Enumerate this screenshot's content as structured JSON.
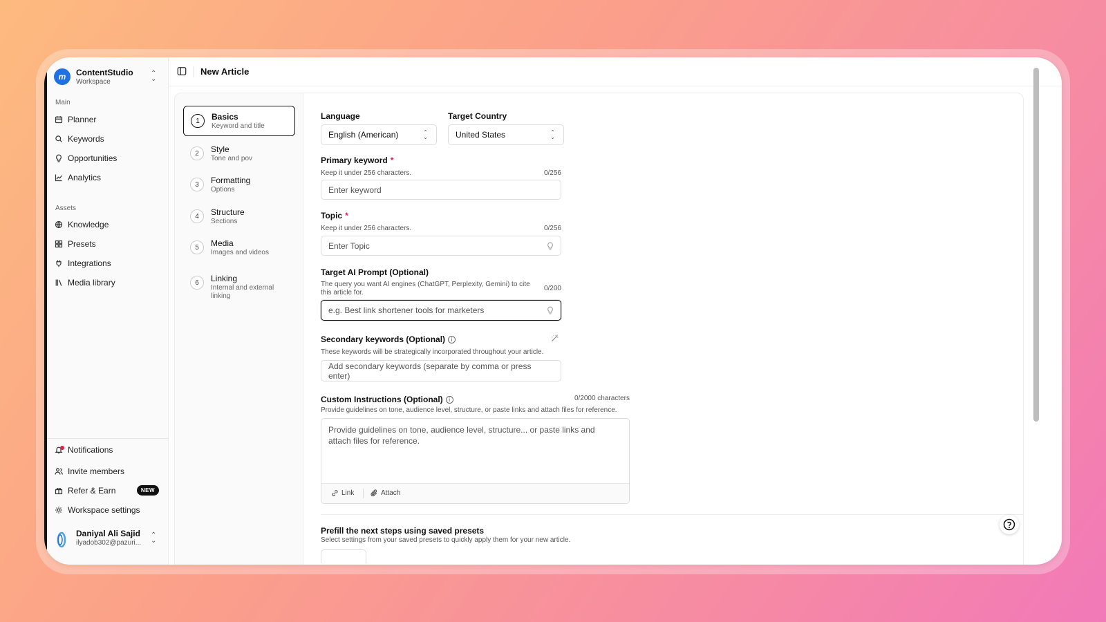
{
  "workspace": {
    "name": "ContentStudio",
    "sub": "Workspace",
    "logo": "m"
  },
  "sidebar": {
    "main_label": "Main",
    "main_items": [
      {
        "label": "Planner",
        "icon": "calendar-icon"
      },
      {
        "label": "Keywords",
        "icon": "search-icon"
      },
      {
        "label": "Opportunities",
        "icon": "lightbulb-icon"
      },
      {
        "label": "Analytics",
        "icon": "chart-line-icon"
      }
    ],
    "assets_label": "Assets",
    "assets_items": [
      {
        "label": "Knowledge",
        "icon": "globe-icon"
      },
      {
        "label": "Presets",
        "icon": "grid-icon"
      },
      {
        "label": "Integrations",
        "icon": "plug-icon"
      },
      {
        "label": "Media library",
        "icon": "library-icon"
      }
    ],
    "bottom_items": [
      {
        "label": "Notifications",
        "icon": "bell-icon"
      },
      {
        "label": "Invite members",
        "icon": "users-icon"
      },
      {
        "label": "Refer & Earn",
        "icon": "gift-icon",
        "badge": "NEW"
      },
      {
        "label": "Workspace settings",
        "icon": "gear-icon"
      }
    ],
    "user": {
      "name": "Daniyal Ali Sajid",
      "email": "ilyadob302@pazuri..."
    }
  },
  "header": {
    "title": "New Article"
  },
  "steps": [
    {
      "num": "1",
      "title": "Basics",
      "sub": "Keyword and title"
    },
    {
      "num": "2",
      "title": "Style",
      "sub": "Tone and pov"
    },
    {
      "num": "3",
      "title": "Formatting",
      "sub": "Options"
    },
    {
      "num": "4",
      "title": "Structure",
      "sub": "Sections"
    },
    {
      "num": "5",
      "title": "Media",
      "sub": "Images and videos"
    },
    {
      "num": "6",
      "title": "Linking",
      "sub": "Internal and external linking"
    }
  ],
  "form": {
    "language": {
      "label": "Language",
      "value": "English (American)"
    },
    "country": {
      "label": "Target Country",
      "value": "United States"
    },
    "primary_keyword": {
      "label": "Primary keyword",
      "required": "*",
      "hint": "Keep it under 256 characters.",
      "count": "0/256",
      "placeholder": "Enter keyword"
    },
    "topic": {
      "label": "Topic",
      "required": "*",
      "hint": "Keep it under 256 characters.",
      "count": "0/256",
      "placeholder": "Enter Topic"
    },
    "ai_prompt": {
      "label": "Target AI Prompt (Optional)",
      "hint": "The query you want AI engines (ChatGPT, Perplexity, Gemini) to cite this article for.",
      "count": "0/200",
      "placeholder": "e.g. Best link shortener tools for marketers"
    },
    "secondary": {
      "label": "Secondary keywords (Optional)",
      "hint": "These keywords will be strategically incorporated throughout your article.",
      "placeholder": "Add secondary keywords (separate by comma or press enter)"
    },
    "custom": {
      "label": "Custom Instructions (Optional)",
      "count": "0/2000 characters",
      "hint": "Provide guidelines on tone, audience level, structure, or paste links and attach files for reference.",
      "placeholder": "Provide guidelines on tone, audience level, structure... or paste links and attach files for reference.",
      "link_label": "Link",
      "attach_label": "Attach"
    },
    "presets": {
      "title": "Prefill the next steps using saved presets",
      "hint": "Select settings from your saved presets to quickly apply them for your new article."
    }
  }
}
